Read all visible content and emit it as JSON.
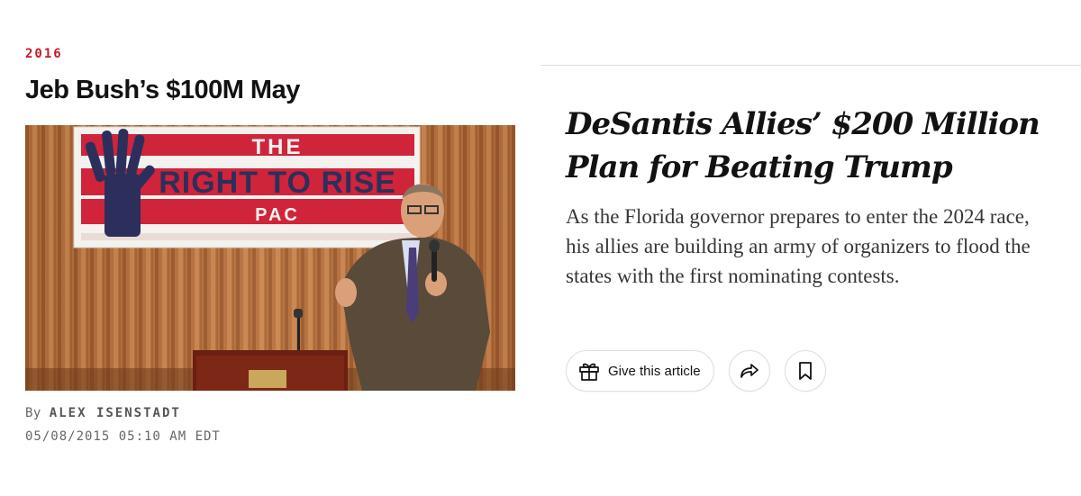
{
  "left_article": {
    "kicker": "2016",
    "title": "Jeb Bush’s $100M May",
    "photo": {
      "banner_line1": "THE",
      "banner_line2": "RIGHT TO RISE",
      "banner_line3": "PAC",
      "banner_icon": "raised-hand-icon"
    },
    "byline_prefix": "By",
    "byline_author": "ALEX ISENSTADT",
    "timestamp": "05/08/2015 05:10 AM EDT"
  },
  "right_article": {
    "headline": "DeSantis Allies’ $200 Million Plan for Beating Trump",
    "summary": "As the Florida governor prepares to enter the 2024 race, his allies are building an army of organizers to flood the states with the first nominating contests.",
    "actions": {
      "gift_label": "Give this article",
      "gift_icon": "gift-icon",
      "share_icon": "share-arrow-icon",
      "save_icon": "bookmark-icon"
    }
  },
  "colors": {
    "kicker_red": "#c3182a",
    "banner_red": "#d0243a",
    "banner_navy": "#2c2f5c",
    "curtain": "#b7703e",
    "divider": "#dcdcdc"
  }
}
